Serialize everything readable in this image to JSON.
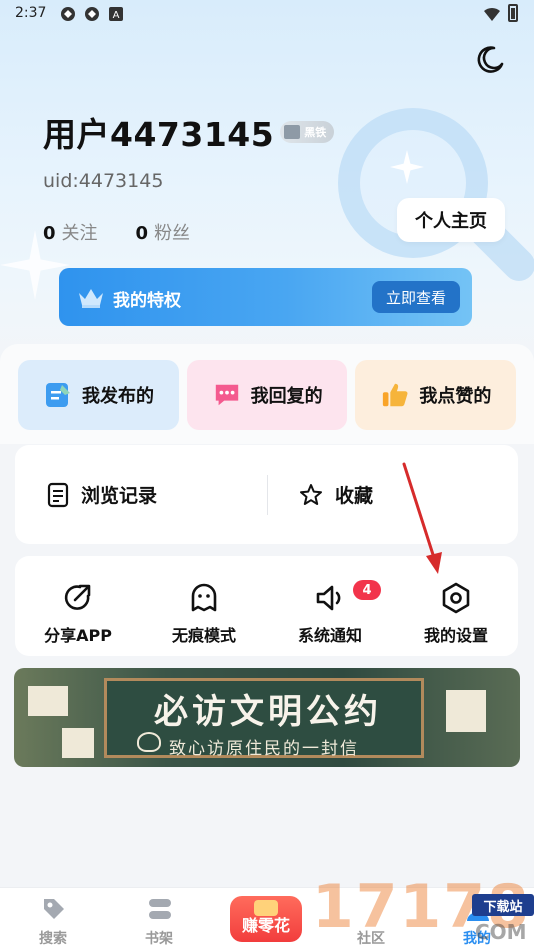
{
  "status_bar": {
    "time": "2:37"
  },
  "profile": {
    "username": "用户4473145",
    "level_badge": "黑铁",
    "uid": "uid:4473145",
    "following_count": "0",
    "following_label": "关注",
    "followers_count": "0",
    "followers_label": "粉丝",
    "profile_button": "个人主页"
  },
  "privilege": {
    "label": "我的特权",
    "button": "立即查看"
  },
  "quick_actions": [
    {
      "label": "我发布的"
    },
    {
      "label": "我回复的"
    },
    {
      "label": "我点赞的"
    }
  ],
  "history": {
    "browse": "浏览记录",
    "favorites": "收藏"
  },
  "tools": [
    {
      "label": "分享APP",
      "icon": "share-icon"
    },
    {
      "label": "无痕模式",
      "icon": "ghost-icon"
    },
    {
      "label": "系统通知",
      "icon": "speaker-icon",
      "badge": "4"
    },
    {
      "label": "我的设置",
      "icon": "settings-icon"
    }
  ],
  "promo": {
    "title": "必访文明公约",
    "subtitle": "致心访原住民的一封信"
  },
  "bottom_nav": [
    {
      "label": "搜索",
      "icon": "search-tag-icon"
    },
    {
      "label": "书架",
      "icon": "bookshelf-icon"
    },
    {
      "label": "赚零花",
      "icon": "gift-icon"
    },
    {
      "label": "社区",
      "icon": "community-icon"
    },
    {
      "label": "我的",
      "icon": "profile-icon",
      "active": true
    }
  ],
  "watermark": {
    "digits": "17178",
    "tag": "下载站",
    "suffix": "COM"
  },
  "colors": {
    "accent_blue": "#2f93ee",
    "badge_red": "#f2344b",
    "annotation_arrow": "#d62b2b"
  }
}
